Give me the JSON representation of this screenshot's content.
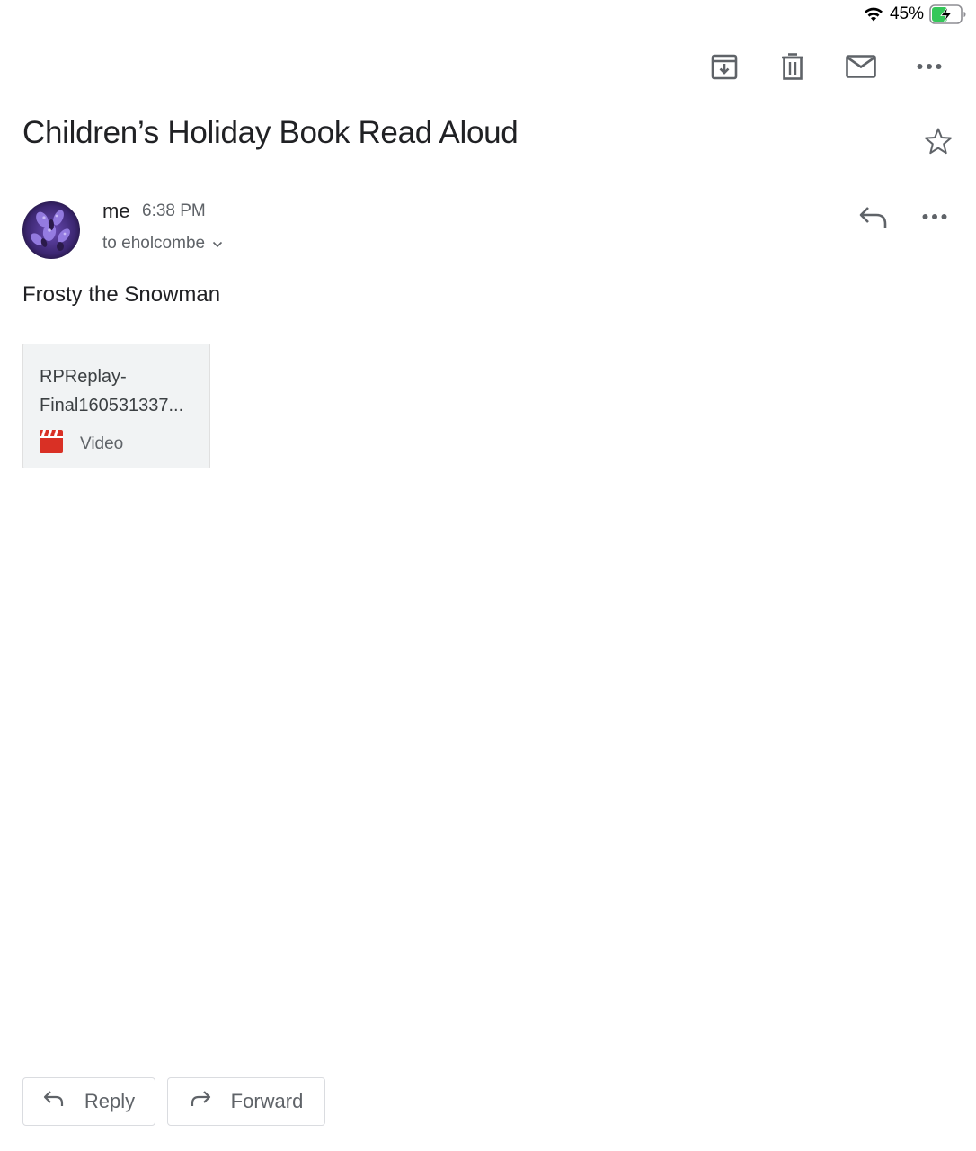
{
  "status_bar": {
    "battery_percent": "45%",
    "battery_level": 0.45,
    "charging": true,
    "icons": [
      "wifi-icon",
      "battery-charging-icon"
    ]
  },
  "toolbar": {
    "icons": [
      "archive-icon",
      "trash-icon",
      "mail-unread-icon",
      "more-horizontal-icon"
    ]
  },
  "email": {
    "subject": "Children’s Holiday Book Read Aloud",
    "sender": "me",
    "time": "6:38 PM",
    "recipient": "to eholcombe",
    "body": "Frosty the Snowman"
  },
  "attachment": {
    "name_line1": "RPReplay-",
    "name_line2": "Final160531337...",
    "type": "Video",
    "icon": "video-file-icon",
    "icon_color": "#d93025"
  },
  "actions": {
    "reply_label": "Reply",
    "forward_label": "Forward"
  },
  "colors": {
    "text_primary": "#202124",
    "text_secondary": "#5f6368",
    "battery_green": "#34c759"
  }
}
